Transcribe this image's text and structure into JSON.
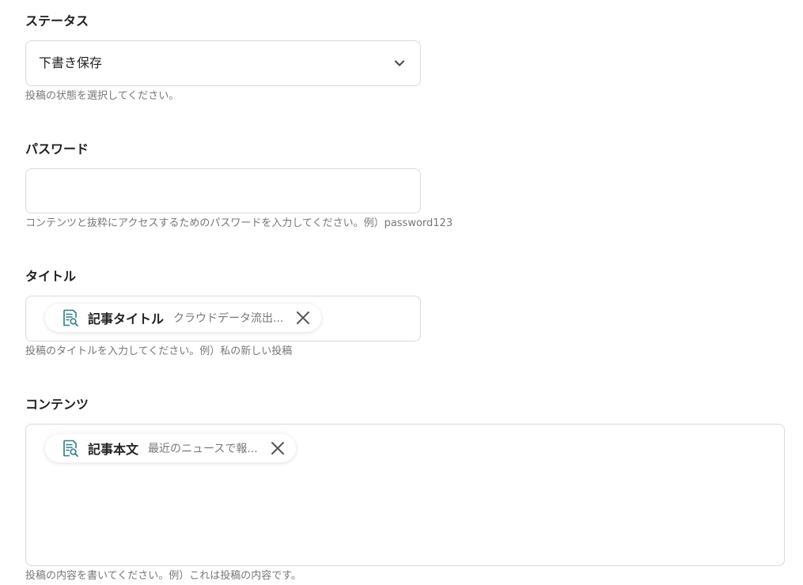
{
  "status_field": {
    "label": "ステータス",
    "selected": "下書き保存",
    "hint": "投稿の状態を選択してください。"
  },
  "password_field": {
    "label": "パスワード",
    "value": "",
    "hint": "コンテンツと抜粋にアクセスするためのパスワードを入力してください。例）password123"
  },
  "title_field": {
    "label": "タイトル",
    "chip_name": "記事タイトル",
    "chip_value": "クラウドデータ流出...",
    "hint": "投稿のタイトルを入力してください。例）私の新しい投稿"
  },
  "content_field": {
    "label": "コンテンツ",
    "chip_name": "記事本文",
    "chip_value": "最近のニュースで報...",
    "hint": "投稿の内容を書いてください。例）これは投稿の内容です。"
  },
  "icons": {
    "dropdown": "chevron-down-icon",
    "chip": "document-search-icon",
    "remove": "close-icon"
  },
  "colors": {
    "icon_teal": "#2a7f88",
    "border": "#d9d9d9",
    "hint_text": "#777777"
  }
}
